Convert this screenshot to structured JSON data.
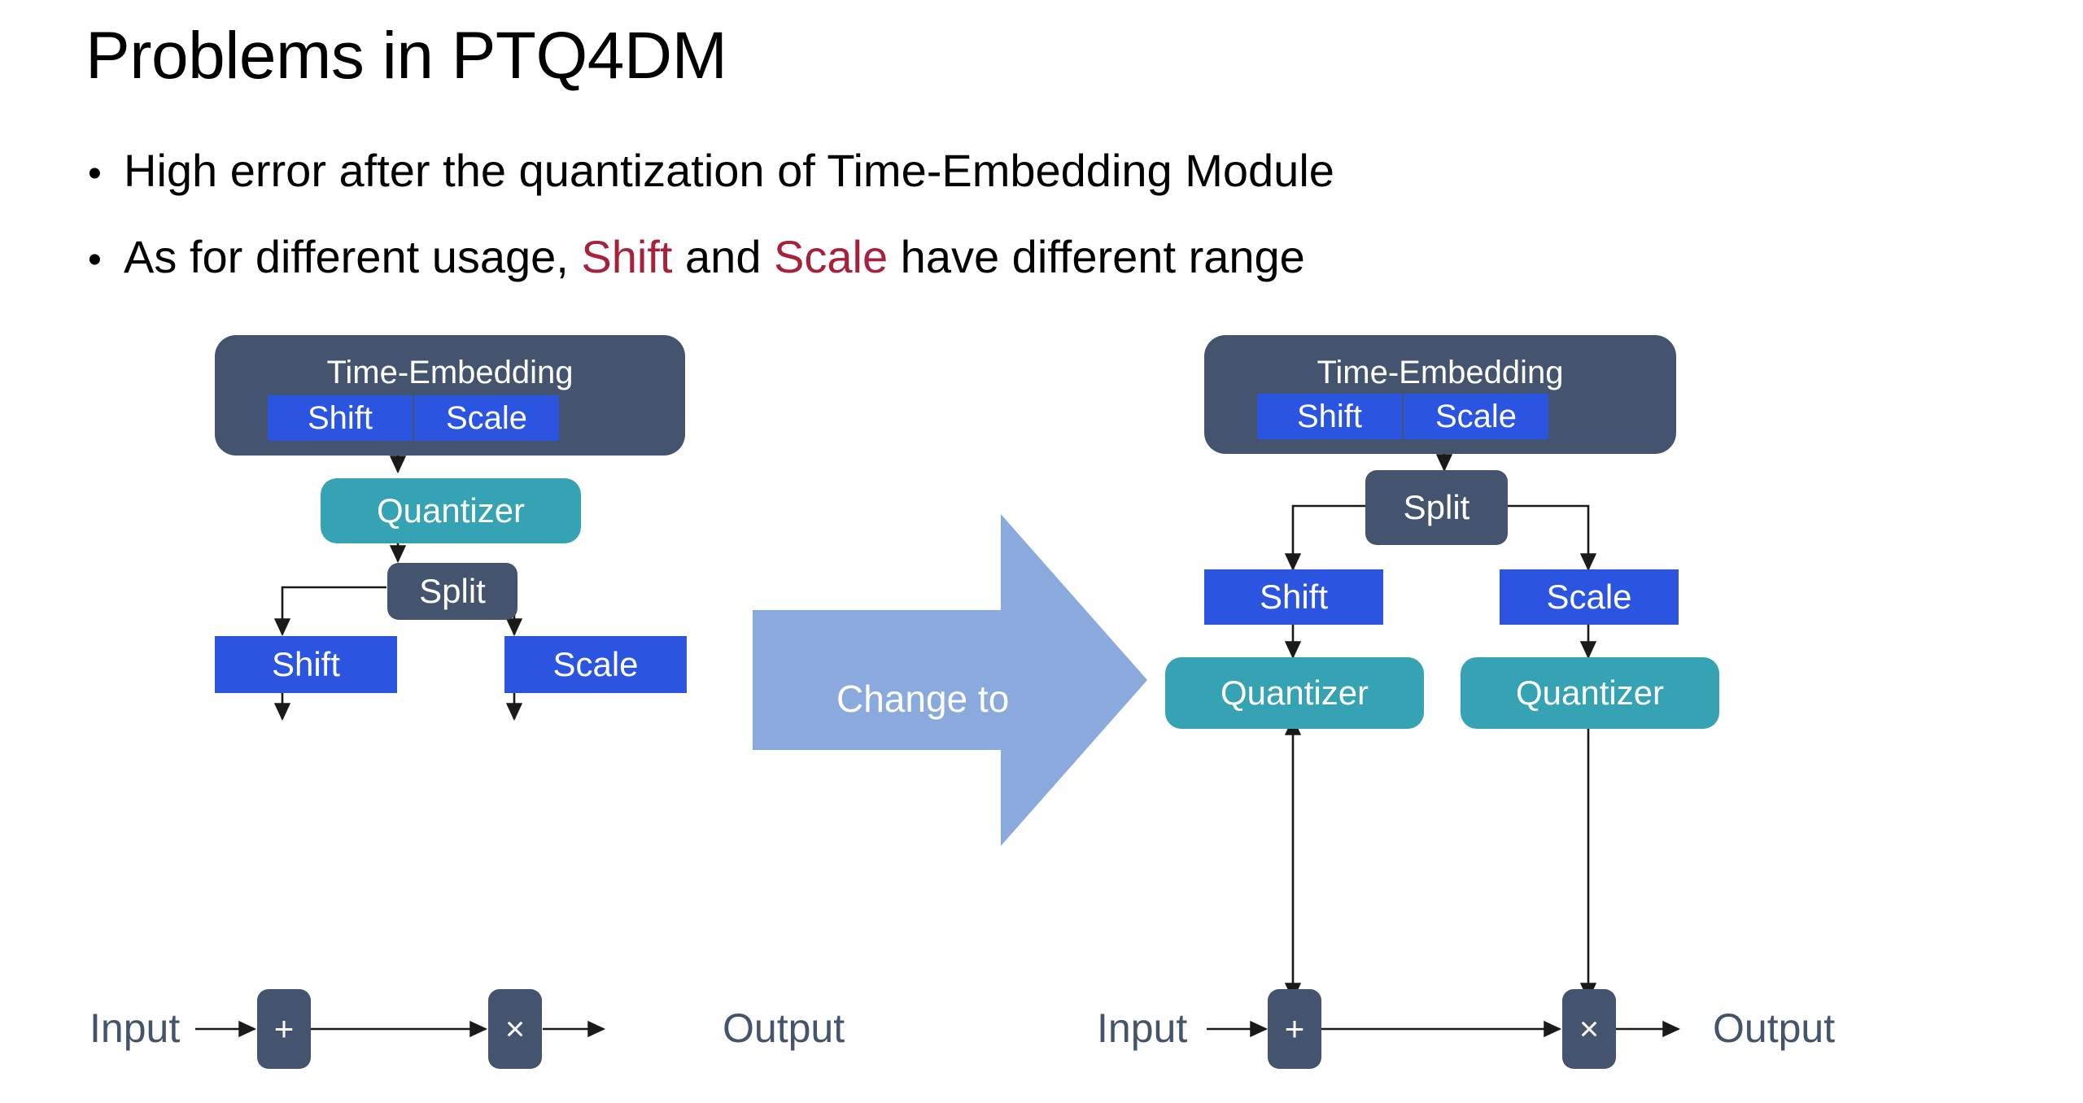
{
  "slide": {
    "title": "Problems in PTQ4DM",
    "bullet_marker": "•",
    "bullets": [
      {
        "id": "bullet-high-error",
        "segments": [
          {
            "text": "High error after the quantization of Time-Embedding Module",
            "accent": false
          }
        ]
      },
      {
        "id": "bullet-different-range",
        "segments": [
          {
            "text": "As for different usage, ",
            "accent": false
          },
          {
            "text": "Shift",
            "accent": true
          },
          {
            "text": " and ",
            "accent": false
          },
          {
            "text": "Scale",
            "accent": true
          },
          {
            "text": " have different range",
            "accent": false
          }
        ]
      }
    ]
  },
  "colors": {
    "slate": "#44546f",
    "blue": "#2b55e0",
    "teal": "#35a3b3",
    "arrow_fill": "#8aa9dd",
    "io_text": "#44546a",
    "accent_red": "#a8213a",
    "wire": "#1a1a1a",
    "background": "#ffffff"
  },
  "transition_arrow": {
    "label": "Change to"
  },
  "left_diagram": {
    "name": "PTQ4DM baseline pipeline",
    "time_embedding": {
      "title": "Time-Embedding",
      "sub_blocks": [
        {
          "label": "Shift"
        },
        {
          "label": "Scale"
        }
      ]
    },
    "quantizer": {
      "label": "Quantizer"
    },
    "split": {
      "label": "Split"
    },
    "branches": [
      {
        "label": "Shift",
        "op": "+"
      },
      {
        "label": "Scale",
        "op": "×"
      }
    ],
    "io": {
      "input": "Input",
      "output": "Output"
    }
  },
  "right_diagram": {
    "name": "Proposed split-then-quantize pipeline",
    "time_embedding": {
      "title": "Time-Embedding",
      "sub_blocks": [
        {
          "label": "Shift"
        },
        {
          "label": "Scale"
        }
      ]
    },
    "split": {
      "label": "Split"
    },
    "branches": [
      {
        "label": "Shift",
        "quantizer": "Quantizer",
        "op": "+"
      },
      {
        "label": "Scale",
        "quantizer": "Quantizer",
        "op": "×"
      }
    ],
    "io": {
      "input": "Input",
      "output": "Output"
    }
  }
}
